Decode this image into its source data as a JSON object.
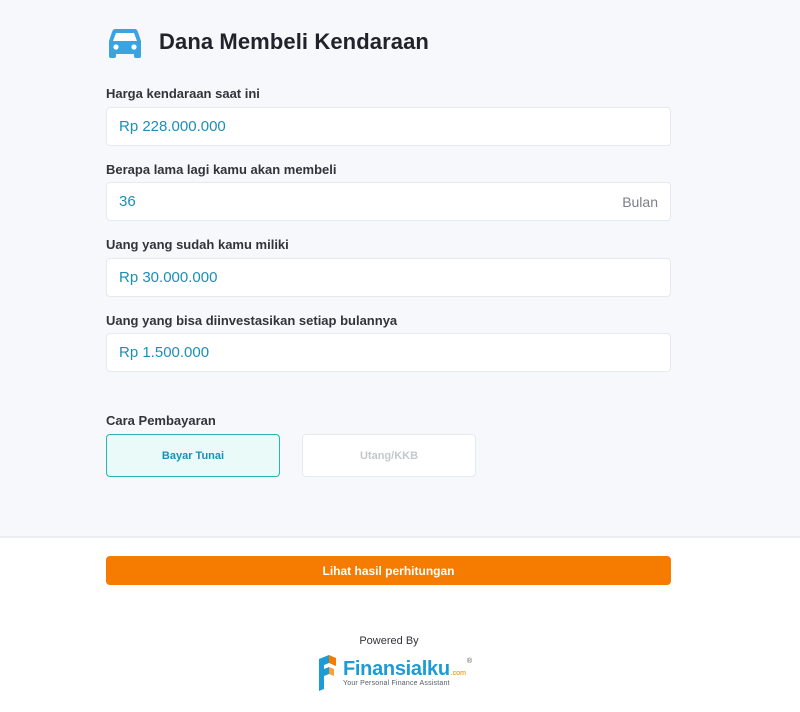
{
  "page": {
    "title": "Dana Membeli Kendaraan",
    "title_icon": "car-icon"
  },
  "fields": [
    {
      "label": "Harga kendaraan saat ini",
      "value": "Rp 228.000.000",
      "suffix": ""
    },
    {
      "label": "Berapa lama lagi kamu akan membeli",
      "value": "36",
      "suffix": "Bulan"
    },
    {
      "label": "Uang yang sudah kamu miliki",
      "value": "Rp 30.000.000",
      "suffix": ""
    },
    {
      "label": "Uang yang bisa diinvestasikan setiap bulannya",
      "value": "Rp 1.500.000",
      "suffix": ""
    }
  ],
  "payment": {
    "label": "Cara Pembayaran",
    "options": [
      {
        "label": "Bayar Tunai",
        "selected": true
      },
      {
        "label": "Utang/KKB",
        "selected": false
      }
    ]
  },
  "cta": {
    "label": "Lihat hasil perhitungan"
  },
  "footer": {
    "powered_by": "Powered By",
    "brand": "Finansialku",
    "brand_suffix": ".com",
    "registered": "®",
    "tagline": "Your Personal Finance Assistant"
  },
  "colors": {
    "accent": "#1c8fb6",
    "cta": "#f57c00",
    "selected_border": "#2ab3b1",
    "selected_bg": "#eafaf9"
  }
}
